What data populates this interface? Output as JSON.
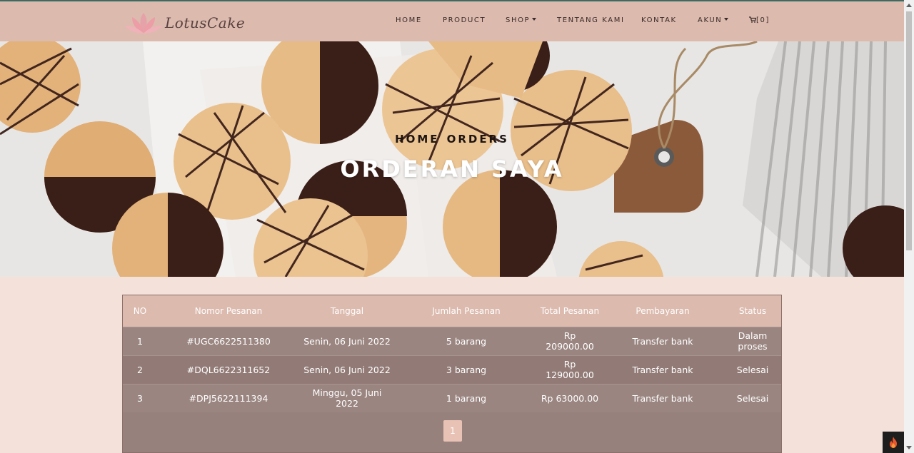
{
  "brand": {
    "name": "LotusCake"
  },
  "nav": {
    "items": [
      {
        "label": "HOME"
      },
      {
        "label": "PRODUCT"
      },
      {
        "label": "SHOP"
      },
      {
        "label": "TENTANG KAMI"
      },
      {
        "label": "KONTAK"
      },
      {
        "label": "AKUN"
      }
    ],
    "cart_count": "[0]"
  },
  "hero": {
    "breadcrumb_home": "HOME",
    "breadcrumb_current": "ORDERS",
    "title": "ORDERAN SAYA"
  },
  "table": {
    "headers": [
      "NO",
      "Nomor Pesanan",
      "Tanggal",
      "Jumlah Pesanan",
      "Total Pesanan",
      "Pembayaran",
      "Status"
    ],
    "rows": [
      [
        "1",
        "#UGC6622511380",
        "Senin, 06 Juni 2022",
        "5 barang",
        "Rp 209000.00",
        "Transfer bank",
        "Dalam proses"
      ],
      [
        "2",
        "#DQL6622311652",
        "Senin, 06 Juni 2022",
        "3 barang",
        "Rp 129000.00",
        "Transfer bank",
        "Selesai"
      ],
      [
        "3",
        "#DPJ5622111394",
        "Minggu, 05 Juni 2022",
        "1 barang",
        "Rp 63000.00",
        "Transfer bank",
        "Selesai"
      ]
    ]
  },
  "pagination": {
    "current": "1"
  },
  "colors": {
    "navbar": "#dcbaae",
    "page_bg": "#f4e1da",
    "table_body": "#97817c",
    "pager_active": "#e8c2b4"
  },
  "icons": [
    "lotus-logo-icon",
    "cart-icon",
    "caret-down-icon",
    "flame-icon"
  ]
}
